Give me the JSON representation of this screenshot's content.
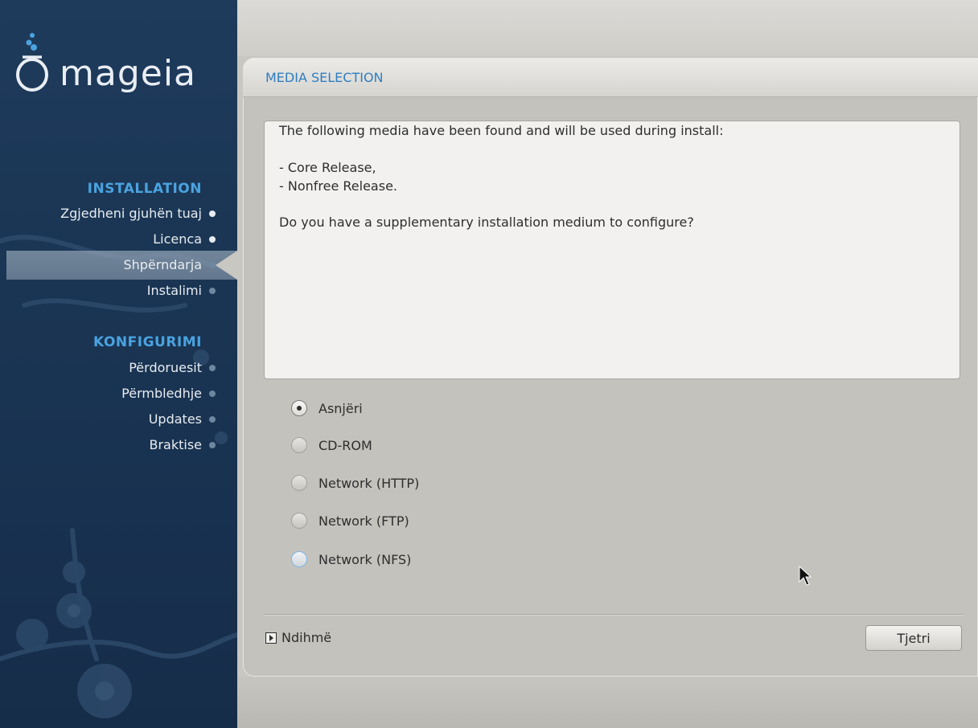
{
  "app": {
    "brand": "mageia"
  },
  "sidebar": {
    "sections": [
      {
        "title": "INSTALLATION",
        "items": [
          {
            "label": "Zgjedheni gjuhën tuaj",
            "state": "done"
          },
          {
            "label": "Licenca",
            "state": "done"
          },
          {
            "label": "Shpërndarja",
            "state": "current"
          },
          {
            "label": "Instalimi",
            "state": "pending"
          }
        ]
      },
      {
        "title": "KONFIGURIMI",
        "items": [
          {
            "label": "Përdoruesit",
            "state": "pending"
          },
          {
            "label": "Përmbledhje",
            "state": "pending"
          },
          {
            "label": "Updates",
            "state": "pending"
          },
          {
            "label": "Braktise",
            "state": "pending"
          }
        ]
      }
    ]
  },
  "page": {
    "title": "MEDIA SELECTION",
    "info_lines": [
      "The following media have been found and will be used during install:",
      "- Core Release,",
      "- Nonfree Release.",
      "Do you have a supplementary installation medium to configure?"
    ],
    "options": [
      {
        "label": "Asnjëri",
        "selected": true
      },
      {
        "label": "CD-ROM",
        "selected": false
      },
      {
        "label": "Network (HTTP)",
        "selected": false
      },
      {
        "label": "Network (FTP)",
        "selected": false
      },
      {
        "label": "Network (NFS)",
        "selected": false
      }
    ],
    "help_label": "Ndihmë",
    "next_label": "Tjetri"
  },
  "colors": {
    "sidebar_bg": "#1a3553",
    "section_title": "#4aa3e0",
    "page_title": "#2f7ec0",
    "panel_bg": "#c4c2bd"
  }
}
